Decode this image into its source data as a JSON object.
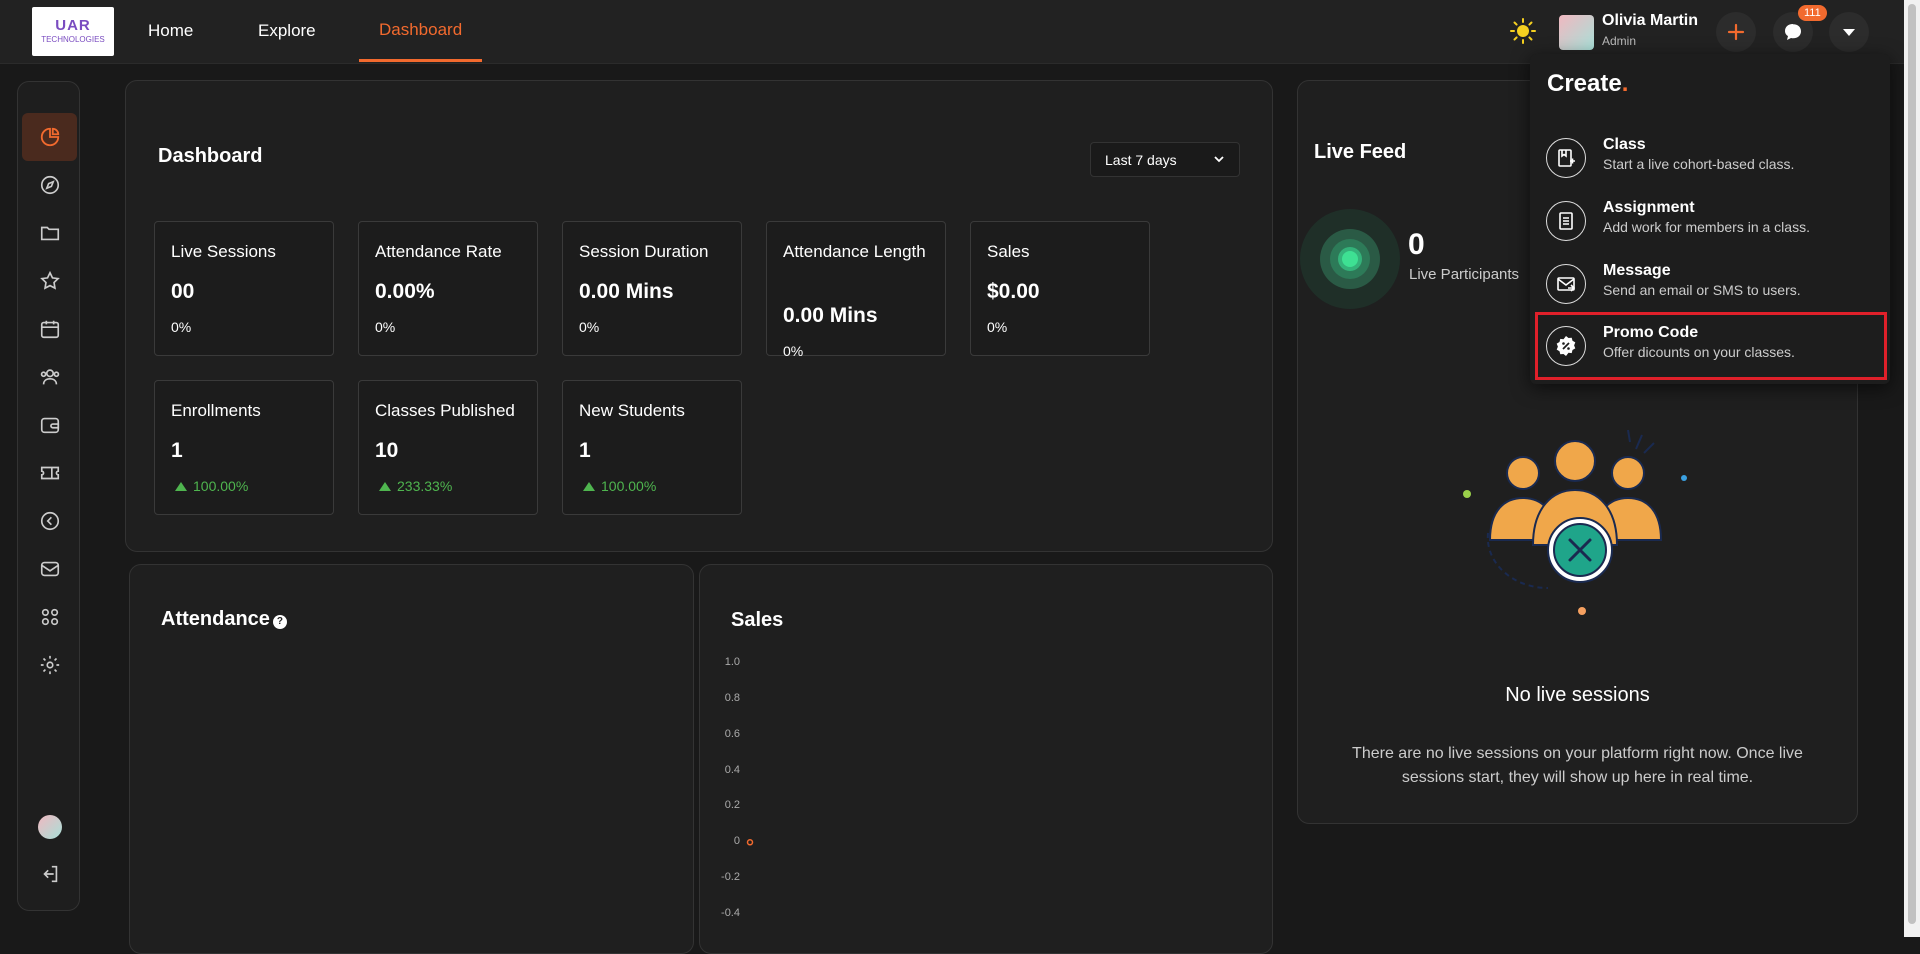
{
  "header": {
    "logo_line1": "UAR",
    "logo_line2": "TECHNOLOGIES",
    "nav": [
      "Home",
      "Explore",
      "Dashboard"
    ],
    "user_name": "Olivia Martin",
    "user_role": "Admin",
    "notif_count": "111",
    "accent": "#f26a2e"
  },
  "sidebar": {
    "icons": [
      "pie-chart-icon",
      "compass-icon",
      "folder-icon",
      "star-icon",
      "calendar-icon",
      "users-icon",
      "wallet-icon",
      "ticket-icon",
      "chevron-left-circle-icon",
      "mail-icon",
      "apps-grid-icon",
      "settings-icon",
      "avatar",
      "logout-icon"
    ]
  },
  "dashboard": {
    "title": "Dashboard",
    "range": "Last 7 days",
    "cards": [
      {
        "label": "Live Sessions",
        "value": "00",
        "change": "0%"
      },
      {
        "label": "Attendance Rate",
        "value": "0.00%",
        "change": "0%"
      },
      {
        "label": "Session Duration",
        "value": "0.00 Mins",
        "change": "0%"
      },
      {
        "label": "Attendance Length",
        "value": "0.00 Mins",
        "change": "0%"
      },
      {
        "label": "Sales",
        "value": "$0.00",
        "change": "0%"
      },
      {
        "label": "Enrollments",
        "value": "1",
        "change": "100.00%"
      },
      {
        "label": "Classes Published",
        "value": "10",
        "change": "233.33%"
      },
      {
        "label": "New Students",
        "value": "1",
        "change": "100.00%"
      }
    ]
  },
  "attendance": {
    "title": "Attendance"
  },
  "sales": {
    "title": "Sales",
    "yticks": [
      "1.0",
      "0.8",
      "0.6",
      "0.4",
      "0.2",
      "0",
      "-0.2",
      "-0.4"
    ]
  },
  "chart_data": {
    "type": "line",
    "title": "Sales",
    "y_ticks": [
      1.0,
      0.8,
      0.6,
      0.4,
      0.2,
      0,
      -0.2,
      -0.4
    ],
    "ylim": [
      -0.4,
      1.0
    ],
    "series": [
      {
        "values": [
          0
        ]
      }
    ]
  },
  "live_feed": {
    "title": "Live Feed",
    "count": "0",
    "count_label": "Live Participants",
    "empty_title": "No live sessions",
    "empty_desc_1": "There are no live sessions on your platform right now. Once live",
    "empty_desc_2": "sessions start, they will show up here in real time."
  },
  "create_menu": {
    "title": "Create",
    "dot": ".",
    "items": [
      {
        "title": "Class",
        "desc": "Start a live cohort-based class."
      },
      {
        "title": "Assignment",
        "desc": "Add work for members in a class."
      },
      {
        "title": "Message",
        "desc": "Send an email or SMS to users."
      },
      {
        "title": "Promo Code",
        "desc": "Offer dicounts on your classes."
      }
    ]
  }
}
